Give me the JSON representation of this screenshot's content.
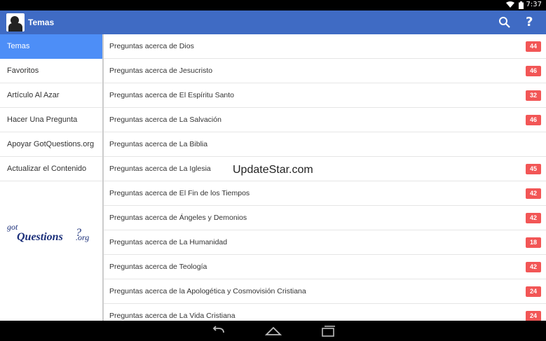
{
  "status_bar": {
    "time": "7:37",
    "icons": [
      "wifi-icon",
      "battery-icon"
    ]
  },
  "app_bar": {
    "title": "Temas",
    "icons": [
      "app-logo",
      "search-icon",
      "help-icon"
    ],
    "help_glyph": "?",
    "color": "#3f6bc4"
  },
  "sidebar": {
    "items": [
      {
        "label": "Temas",
        "active": true
      },
      {
        "label": "Favoritos",
        "active": false
      },
      {
        "label": "Artículo Al Azar",
        "active": false
      },
      {
        "label": "Hacer Una Pregunta",
        "active": false
      },
      {
        "label": "Apoyar GotQuestions.org",
        "active": false
      },
      {
        "label": "Actualizar el Contenido",
        "active": false
      }
    ],
    "brand_logo": {
      "line1": "got",
      "line2": "Questions",
      "mark": "?",
      "suffix": ".org"
    },
    "active_color": "#4d8ef7"
  },
  "topics": [
    {
      "label": "Preguntas acerca de Dios",
      "count": "44"
    },
    {
      "label": "Preguntas acerca de Jesucristo",
      "count": "46"
    },
    {
      "label": "Preguntas acerca de El Espíritu Santo",
      "count": "32"
    },
    {
      "label": "Preguntas acerca de La Salvación",
      "count": "46"
    },
    {
      "label": "Preguntas acerca de La Biblia",
      "count": ""
    },
    {
      "label": "Preguntas acerca de La Iglesia",
      "count": "45"
    },
    {
      "label": "Preguntas acerca de El Fin de los Tiempos",
      "count": "42"
    },
    {
      "label": "Preguntas acerca de Ángeles y Demonios",
      "count": "42"
    },
    {
      "label": "Preguntas acerca de La Humanidad",
      "count": "18"
    },
    {
      "label": "Preguntas acerca de Teología",
      "count": "42"
    },
    {
      "label": "Preguntas acerca de la Apologética y Cosmovisión Cristiana",
      "count": "24"
    },
    {
      "label": "Preguntas acerca de La Vida Cristiana",
      "count": "24"
    }
  ],
  "badge_color": "#f25656",
  "watermark": "UpdateStar.com",
  "nav_bar": {
    "icons": [
      "back-icon",
      "home-icon",
      "recents-icon"
    ]
  }
}
